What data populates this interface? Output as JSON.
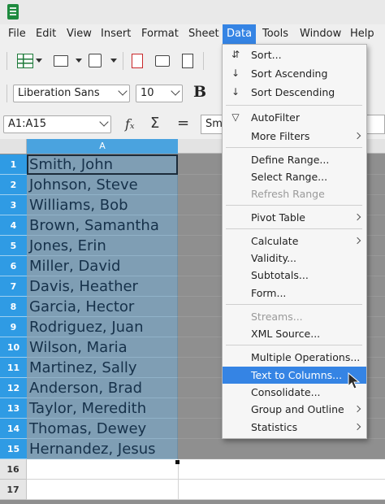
{
  "menubar": [
    "File",
    "Edit",
    "View",
    "Insert",
    "Format",
    "Sheet",
    "Data",
    "Tools",
    "Window",
    "Help"
  ],
  "toolbar": {
    "font_name": "Liberation Sans",
    "font_size": "10",
    "bold_label": "B"
  },
  "formula_bar": {
    "name_box": "A1:A15",
    "function_label": "fₓ",
    "sum_label": "Σ",
    "equals_label": "=",
    "input_text": "Sm"
  },
  "sheet": {
    "column_a": "A",
    "rows": [
      {
        "num": "1",
        "value": "Smith, John"
      },
      {
        "num": "2",
        "value": "Johnson, Steve"
      },
      {
        "num": "3",
        "value": "Williams, Bob"
      },
      {
        "num": "4",
        "value": "Brown, Samantha"
      },
      {
        "num": "5",
        "value": "Jones, Erin"
      },
      {
        "num": "6",
        "value": "Miller, David"
      },
      {
        "num": "7",
        "value": "Davis, Heather"
      },
      {
        "num": "8",
        "value": "Garcia, Hector"
      },
      {
        "num": "9",
        "value": "Rodriguez, Juan"
      },
      {
        "num": "10",
        "value": "Wilson, Maria"
      },
      {
        "num": "11",
        "value": "Martinez, Sally"
      },
      {
        "num": "12",
        "value": "Anderson, Brad"
      },
      {
        "num": "13",
        "value": "Taylor, Meredith"
      },
      {
        "num": "14",
        "value": "Thomas, Dewey"
      },
      {
        "num": "15",
        "value": "Hernandez, Jesus"
      },
      {
        "num": "16",
        "value": ""
      },
      {
        "num": "17",
        "value": ""
      }
    ]
  },
  "data_menu": [
    {
      "label": "Sort...",
      "icon": "sort-icon",
      "glyph": "⇵"
    },
    {
      "label": "Sort Ascending",
      "icon": "sort-ascending-icon",
      "glyph": "↓"
    },
    {
      "label": "Sort Descending",
      "icon": "sort-descending-icon",
      "glyph": "↓"
    },
    {
      "label": "AutoFilter",
      "icon": "autofilter-icon",
      "glyph": "▽"
    },
    {
      "label": "More Filters"
    },
    {
      "label": "Define Range..."
    },
    {
      "label": "Select Range..."
    },
    {
      "label": "Refresh Range"
    },
    {
      "label": "Pivot Table"
    },
    {
      "label": "Calculate"
    },
    {
      "label": "Validity..."
    },
    {
      "label": "Subtotals..."
    },
    {
      "label": "Form..."
    },
    {
      "label": "Streams..."
    },
    {
      "label": "XML Source..."
    },
    {
      "label": "Multiple Operations..."
    },
    {
      "label": "Text to Columns..."
    },
    {
      "label": "Consolidate..."
    },
    {
      "label": "Group and Outline"
    },
    {
      "label": "Statistics"
    }
  ],
  "colors": {
    "accent": "#3584e4",
    "selection_fill": "#7f9eb4",
    "row_header_selected": "#2f9be4"
  }
}
